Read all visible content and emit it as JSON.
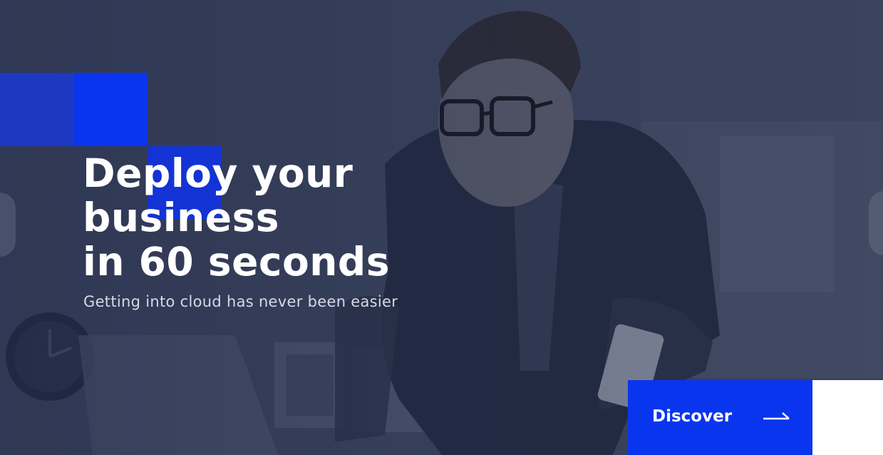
{
  "hero": {
    "headline_lines": [
      "Deploy your",
      "business",
      "in 60 seconds"
    ],
    "subtitle": "Getting into cloud has never been easier",
    "cta": {
      "label": "Discover",
      "icon": "arrow-right-icon"
    }
  },
  "slider": {
    "prev_icon": "chevron-left-icon",
    "next_icon": "chevron-right-icon"
  },
  "colors": {
    "accent": "#0a35ee",
    "overlay": "#3a4258",
    "text": "#ffffff",
    "subtitle": "#d6d9e3"
  }
}
